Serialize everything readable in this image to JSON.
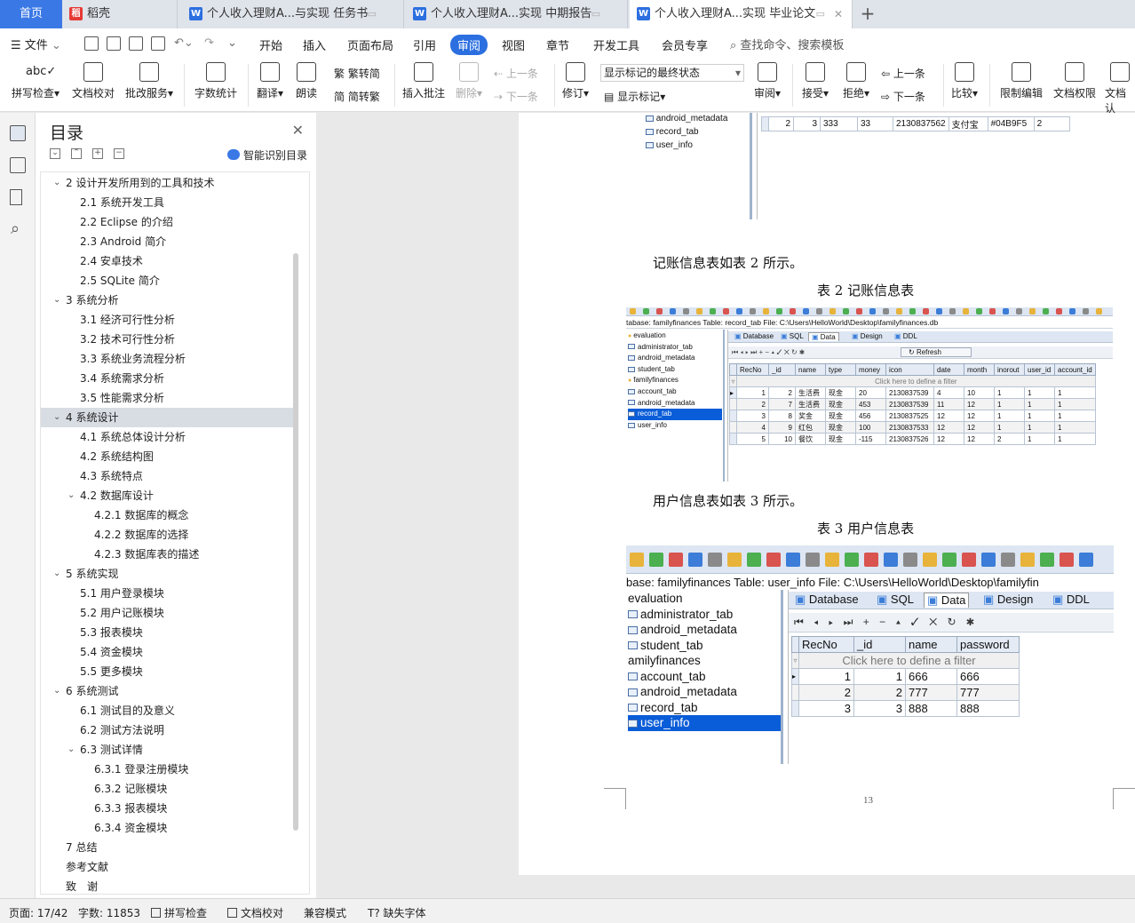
{
  "tabs": {
    "home": "首页",
    "daoke": "稻壳",
    "doc1": "个人收入理财A...与实现 任务书",
    "doc2": "个人收入理财A...实现 中期报告",
    "doc3": "个人收入理财A...实现 毕业论文",
    "add": "+"
  },
  "menu": {
    "file": "文件",
    "tabs": [
      "开始",
      "插入",
      "页面布局",
      "引用",
      "审阅",
      "视图",
      "章节",
      "开发工具",
      "会员专享"
    ],
    "active_tab": "审阅",
    "search": "查找命令、搜索模板"
  },
  "ribbon": {
    "spell": "拼写检查",
    "proof": "文档校对",
    "annotate_service": "批改服务",
    "wordcount": "字数统计",
    "translate": "翻译",
    "read": "朗读",
    "trad": "繁转简",
    "simp": "简转繁",
    "insert_comment": "插入批注",
    "delete": "删除",
    "prev": "上一条",
    "next": "下一条",
    "track": "修订",
    "markup_state": "显示标记的最终状态",
    "show_markup": "显示标记",
    "review": "审阅",
    "accept": "接受",
    "reject": "拒绝",
    "prev2": "上一条",
    "next2": "下一条",
    "compare": "比较",
    "restrict": "限制编辑",
    "doc_perm": "文档权限",
    "doc_cert": "文档认"
  },
  "toc": {
    "title": "目录",
    "smart": "智能识别目录",
    "items": [
      "2 设计开发所用到的工具和技术",
      "2.1 系统开发工具",
      "2.2 Eclipse 的介绍",
      "2.3 Android 简介",
      "2.4 安卓技术",
      "2.5 SQLite 简介",
      "3 系统分析",
      "3.1  经济可行性分析",
      "3.2  技术可行性分析",
      "3.3  系统业务流程分析",
      "3.4  系统需求分析",
      "3.5  性能需求分析",
      "4 系统设计",
      "4.1 系统总体设计分析",
      "4.2 系统结构图",
      "4.3 系统特点",
      "4.2 数据库设计",
      "4.2.1 数据库的概念",
      "4.2.2 数据库的选择",
      "4.2.3 数据库表的描述",
      "5 系统实现",
      "5.1 用户登录模块",
      "5.2 用户记账模块",
      "5.3 报表模块",
      "5.4 资金模块",
      "5.5 更多模块",
      "6 系统测试",
      "6.1 测试目的及意义",
      "6.2 测试方法说明",
      "6.3 测试详情",
      "6.3.1  登录注册模块",
      "6.3.2  记账模块",
      "6.3.3  报表模块",
      "6.3.4  资金模块",
      "7 总结",
      "参考文献",
      "致　谢"
    ]
  },
  "doc": {
    "top_tree": [
      "android_metadata",
      "record_tab",
      "user_info"
    ],
    "top_row": [
      "2",
      "3",
      "333",
      "33",
      "2130837562",
      "支付宝",
      "#04B9F5",
      "2"
    ],
    "para2": "记账信息表如表 2 所示。",
    "cap2": "表 2  记账信息表",
    "para3": "用户信息表如表 3 所示。",
    "cap3": "表 3  用户信息表",
    "page_number": "13"
  },
  "shot2": {
    "path": "tabase: familyfinances   Table: record_tab   File: C:\\Users\\HelloWorld\\Desktop\\familyfinances.db",
    "tree": [
      "evaluation",
      "administrator_tab",
      "android_metadata",
      "student_tab",
      "familyfinances",
      "account_tab",
      "android_metadata",
      "record_tab",
      "user_info"
    ],
    "tabs": [
      "Database",
      "SQL",
      "Data",
      "Design",
      "DDL"
    ],
    "refresh": "Refresh",
    "headers": [
      "RecNo",
      "_id",
      "name",
      "type",
      "money",
      "icon",
      "date",
      "month",
      "inorout",
      "user_id",
      "account_id"
    ],
    "filter": "Click here to define a filter",
    "rows": [
      [
        "1",
        "2",
        "生活费",
        "现金",
        "20",
        "2130837539",
        "4",
        "10",
        "1",
        "1",
        "1"
      ],
      [
        "2",
        "7",
        "生活费",
        "现金",
        "453",
        "2130837539",
        "11",
        "12",
        "1",
        "1",
        "1"
      ],
      [
        "3",
        "8",
        "奖金",
        "现金",
        "456",
        "2130837525",
        "12",
        "12",
        "1",
        "1",
        "1"
      ],
      [
        "4",
        "9",
        "红包",
        "现金",
        "100",
        "2130837533",
        "12",
        "12",
        "1",
        "1",
        "1"
      ],
      [
        "5",
        "10",
        "餐饮",
        "现金",
        "-115",
        "2130837526",
        "12",
        "12",
        "2",
        "1",
        "1"
      ]
    ]
  },
  "shot3": {
    "path": "base: familyfinances   Table: user_info   File: C:\\Users\\HelloWorld\\Desktop\\familyfin",
    "tree": [
      "evaluation",
      "administrator_tab",
      "android_metadata",
      "student_tab",
      "amilyfinances",
      "account_tab",
      "android_metadata",
      "record_tab",
      "user_info"
    ],
    "tabs": [
      "Database",
      "SQL",
      "Data",
      "Design",
      "DDL"
    ],
    "headers": [
      "RecNo",
      "_id",
      "name",
      "password"
    ],
    "filter": "Click here to define a filter",
    "rows": [
      [
        "1",
        "1",
        "666",
        "666"
      ],
      [
        "2",
        "2",
        "777",
        "777"
      ],
      [
        "3",
        "3",
        "888",
        "888"
      ]
    ]
  },
  "status": {
    "page": "页面: 17/42",
    "words": "字数: 11853",
    "spell": "拼写检查",
    "proof": "文档校对",
    "compat": "兼容模式",
    "missing_font": "缺失字体"
  },
  "colors": {
    "accent": "#2c6fe0",
    "home_tab": "#3a78e6",
    "selection": "#0a5dd8"
  }
}
